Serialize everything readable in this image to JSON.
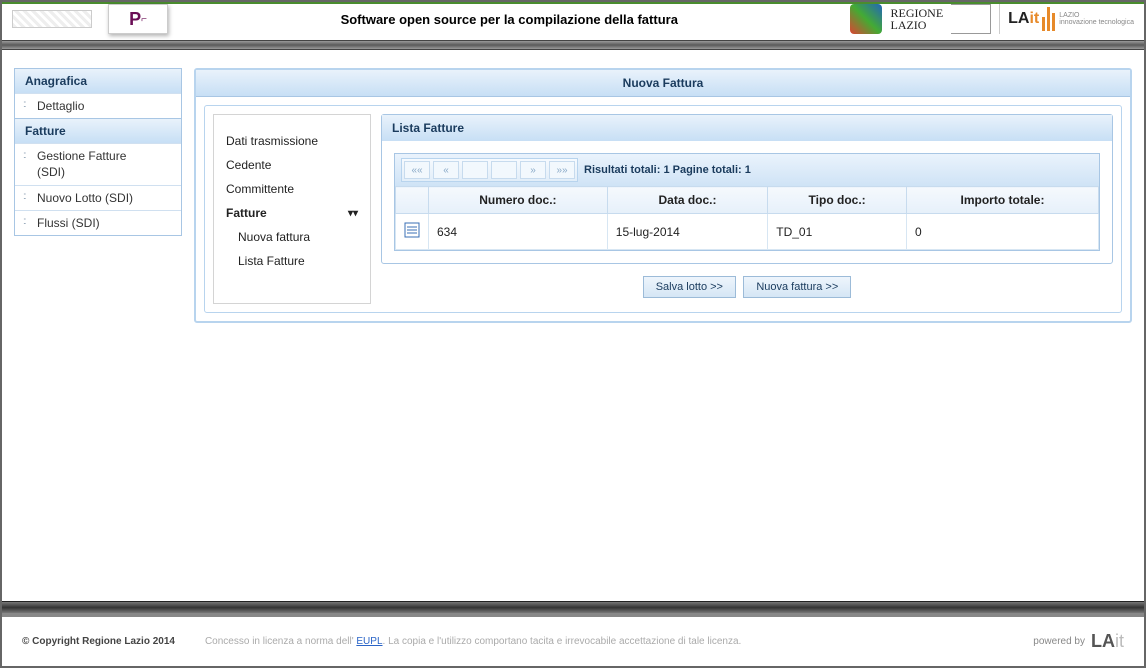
{
  "header": {
    "title": "Software open source per la compilazione della fattura",
    "regione_line1": "REGIONE",
    "regione_line2": "LAZIO",
    "lait_sub1": "LAZIO",
    "lait_sub2": "innovazione tecnologica"
  },
  "sidebar": {
    "section1": "Anagrafica",
    "item_dettaglio": "Dettaglio",
    "section2": "Fatture",
    "item_gestione_l1": "Gestione Fatture",
    "item_gestione_l2": "(SDI)",
    "item_nuovo_lotto": "Nuovo Lotto (SDI)",
    "item_flussi": "Flussi (SDI)"
  },
  "steps": {
    "dati_trasmissione": "Dati trasmissione",
    "cedente": "Cedente",
    "committente": "Committente",
    "fatture": "Fatture",
    "nuova_fattura": "Nuova fattura",
    "lista_fatture": "Lista Fatture"
  },
  "main": {
    "title": "Nuova Fattura",
    "panel_title": "Lista Fatture",
    "pager_counts": "Risultati totali: 1  Pagine totali: 1",
    "table": {
      "headers": {
        "numero": "Numero doc.:",
        "data": "Data doc.:",
        "tipo": "Tipo doc.:",
        "importo": "Importo totale:"
      },
      "rows": [
        {
          "numero": "634",
          "data": "15-lug-2014",
          "tipo": "TD_01",
          "importo": "0"
        }
      ]
    },
    "btn_salva": "Salva lotto >>",
    "btn_nuova": "Nuova fattura >>"
  },
  "footer": {
    "copyright": "© Copyright Regione Lazio 2014",
    "license_pre": "Concesso in licenza a norma dell' ",
    "license_link": "EUPL",
    "license_post": ". La copia e l'utilizzo comportano tacita e irrevocabile accettazione di tale licenza.",
    "powered": "powered by"
  }
}
